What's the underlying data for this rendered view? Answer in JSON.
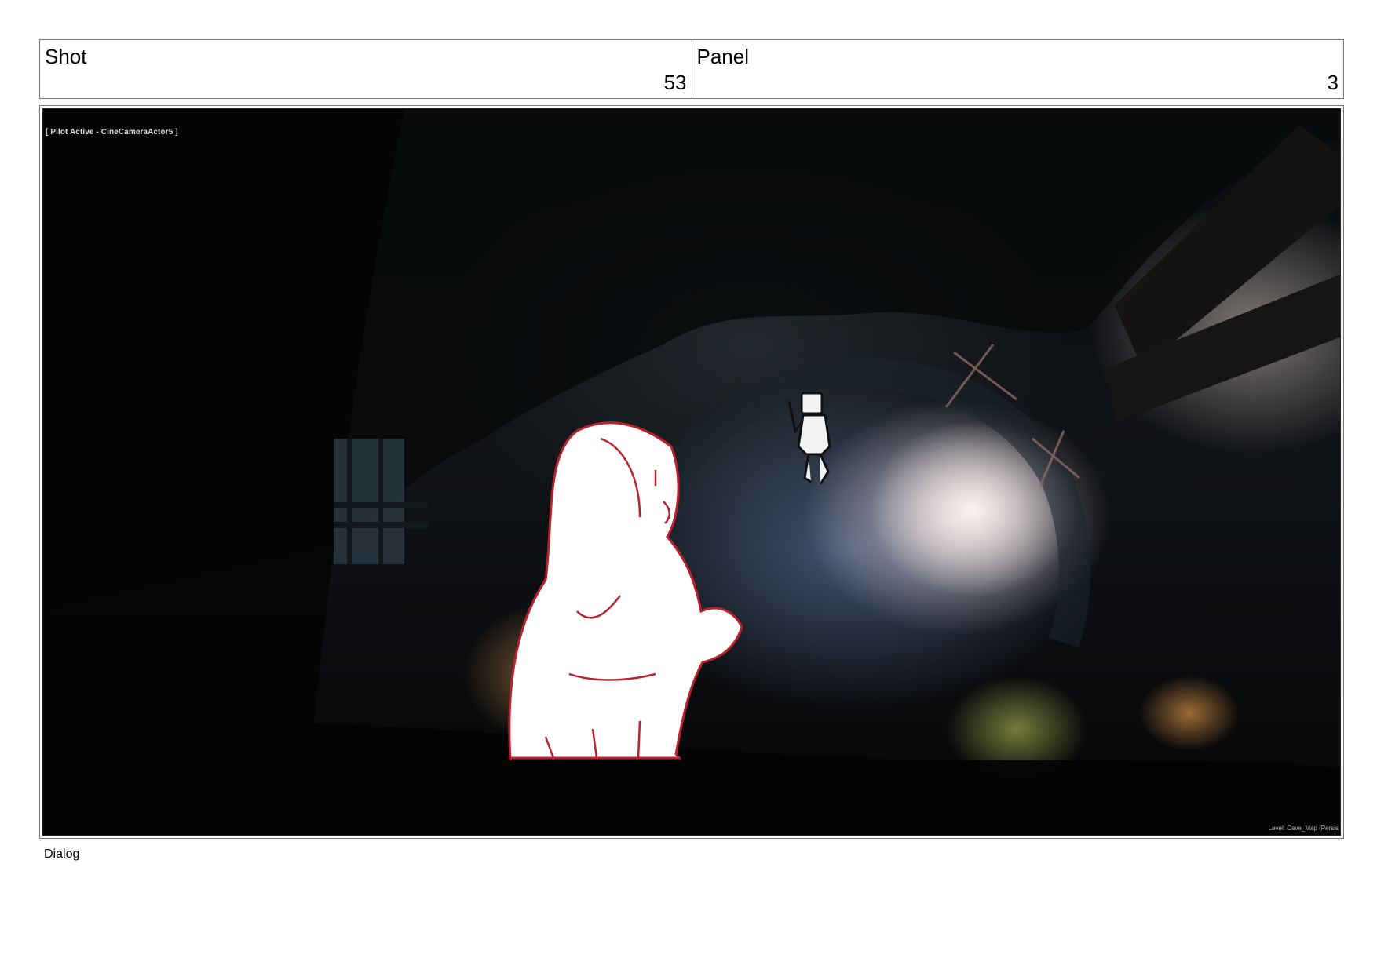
{
  "header": {
    "shot": {
      "label": "Shot",
      "value": "53"
    },
    "panel": {
      "label": "Panel",
      "value": "3"
    }
  },
  "viewport": {
    "hud_top_left": "[ Pilot Active - CineCameraActor5 ]",
    "hud_bottom_right": "Level:  Cave_Map (Persis"
  },
  "dialog": {
    "label": "Dialog"
  }
}
